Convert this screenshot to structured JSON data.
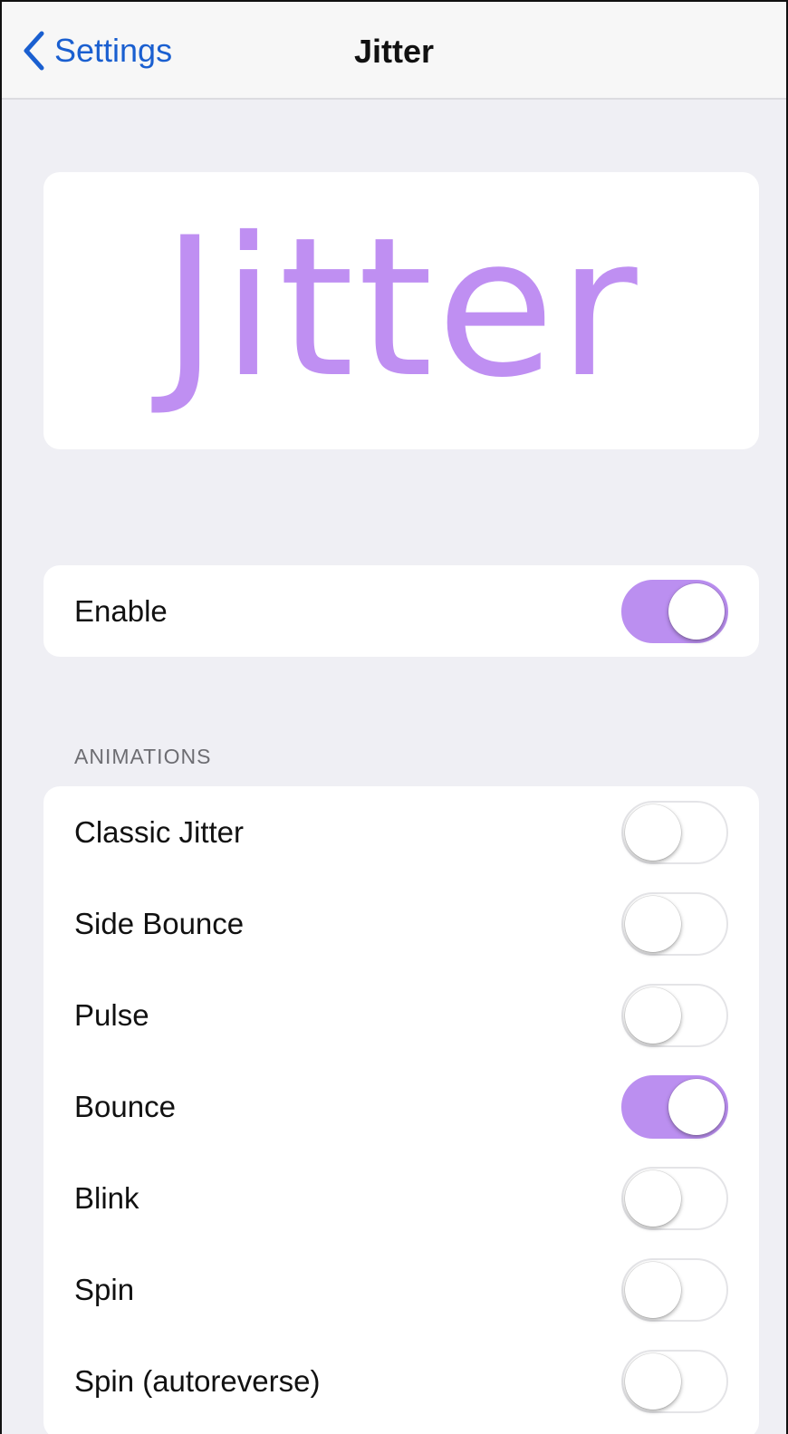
{
  "navbar": {
    "back_label": "Settings",
    "title": "Jitter"
  },
  "logo": {
    "text": "Jitter",
    "color": "#bf8ff2"
  },
  "enable": {
    "label": "Enable",
    "on": true
  },
  "animations": {
    "header": "ANIMATIONS",
    "items": [
      {
        "label": "Classic Jitter",
        "on": false
      },
      {
        "label": "Side Bounce",
        "on": false
      },
      {
        "label": "Pulse",
        "on": false
      },
      {
        "label": "Bounce",
        "on": true
      },
      {
        "label": "Blink",
        "on": false
      },
      {
        "label": "Spin",
        "on": false
      },
      {
        "label": "Spin (autoreverse)",
        "on": false
      }
    ]
  },
  "colors": {
    "accent": "#bb8ff0",
    "link": "#1a5fd0",
    "background": "#efeff4"
  },
  "icons": {
    "back": "chevron-left-icon"
  }
}
